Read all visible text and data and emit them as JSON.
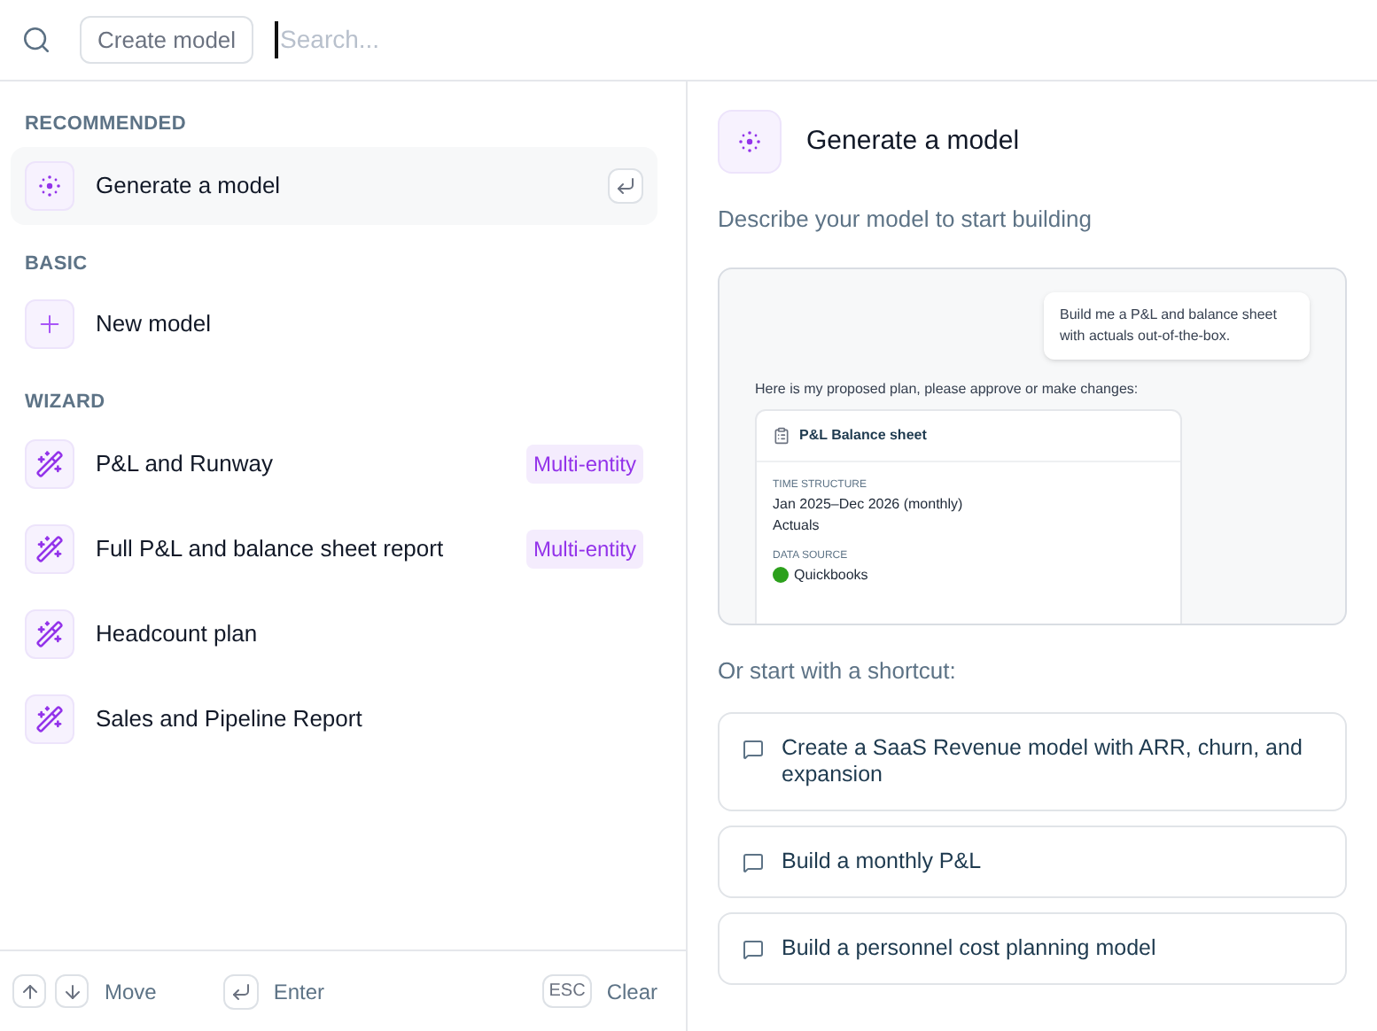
{
  "search": {
    "chip": "Create model",
    "placeholder": "Search..."
  },
  "sections": [
    {
      "title": "RECOMMENDED",
      "items": [
        {
          "label": "Generate a model",
          "kind": "sparkle",
          "selected": true
        }
      ]
    },
    {
      "title": "BASIC",
      "items": [
        {
          "label": "New model",
          "kind": "plus",
          "selected": false
        }
      ]
    },
    {
      "title": "WIZARD",
      "items": [
        {
          "label": "P&L and Runway",
          "kind": "wand",
          "selected": false,
          "badge": "Multi-entity"
        },
        {
          "label": "Full P&L and balance sheet report",
          "kind": "wand",
          "selected": false,
          "badge": "Multi-entity"
        },
        {
          "label": "Headcount plan",
          "kind": "wand",
          "selected": false
        },
        {
          "label": "Sales and Pipeline Report",
          "kind": "wand",
          "selected": false
        }
      ]
    }
  ],
  "footer": {
    "move": "Move",
    "enter": "Enter",
    "esc_key": "ESC",
    "clear": "Clear"
  },
  "detail": {
    "title": "Generate a model",
    "subtitle": "Describe your model to start building",
    "preview": {
      "user_message": "Build me a P&L and balance sheet with actuals out-of-the-box.",
      "intro": "Here is my proposed plan, please approve or make changes:",
      "card": {
        "title": "P&L Balance sheet",
        "fields": [
          {
            "label": "TIME STRUCTURE",
            "kind": "text",
            "lines": [
              "Jan 2025–Dec 2026 (monthly)",
              "Actuals"
            ]
          },
          {
            "label": "DATA SOURCE",
            "kind": "source",
            "lines": [
              "Quickbooks"
            ]
          }
        ]
      }
    },
    "shortcuts_label": "Or start with a shortcut:",
    "shortcuts": [
      "Create a SaaS Revenue model with ARR, churn, and expansion",
      "Build a monthly P&L",
      "Build a personnel cost planning model"
    ]
  }
}
